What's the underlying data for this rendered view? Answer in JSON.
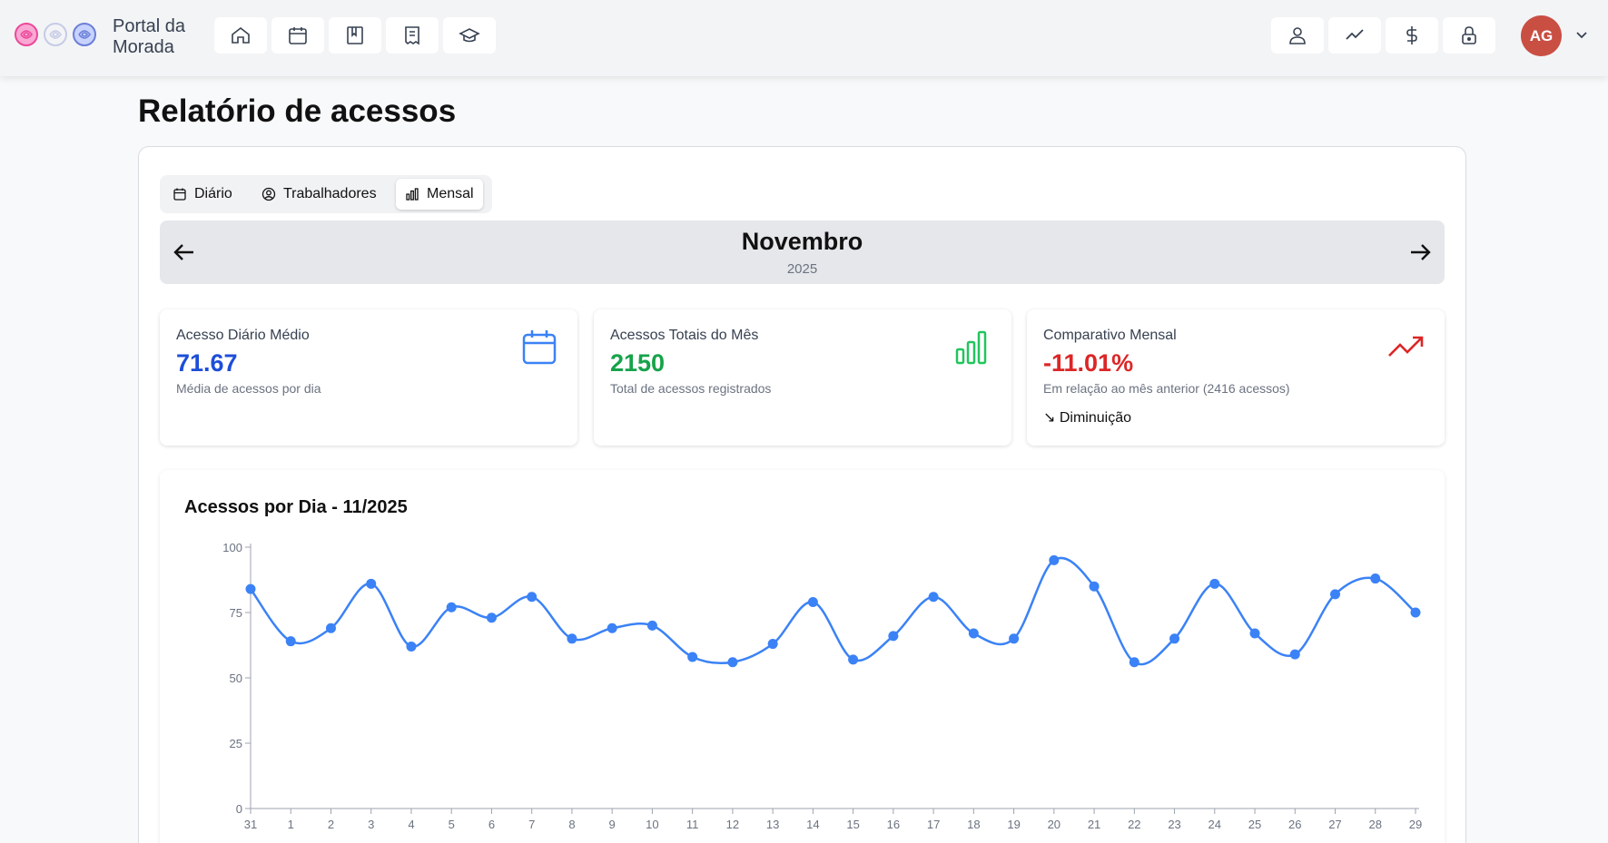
{
  "header": {
    "brand_line1": "Portal da",
    "brand_line2": "Morada",
    "avatar_initials": "AG",
    "avatar_color": "#c94f43"
  },
  "page": {
    "title": "Relatório de acessos"
  },
  "tabs": [
    {
      "label": "Diário",
      "icon": "calendar-icon",
      "active": false
    },
    {
      "label": "Trabalhadores",
      "icon": "user-circle-icon",
      "active": false
    },
    {
      "label": "Mensal",
      "icon": "bar-chart-icon",
      "active": true
    }
  ],
  "month": {
    "name": "Novembro",
    "year": "2025"
  },
  "stats": [
    {
      "label": "Acesso Diário Médio",
      "value": "71.67",
      "desc": "Média de acessos por dia",
      "color": "#1d4ed8",
      "icon": "calendar-icon"
    },
    {
      "label": "Acessos Totais do Mês",
      "value": "2150",
      "desc": "Total de acessos registrados",
      "color": "#16a34a",
      "icon": "bar-chart-icon"
    },
    {
      "label": "Comparativo Mensal",
      "value": "-11.01%",
      "desc": "Em relação ao mês anterior (2416 acessos)",
      "trend": "↘ Diminuição",
      "color": "#dc2626",
      "icon": "trending-up-icon"
    }
  ],
  "chart_data": {
    "type": "line",
    "title": "Acessos por Dia - 11/2025",
    "categories": [
      "31",
      "1",
      "2",
      "3",
      "4",
      "5",
      "6",
      "7",
      "8",
      "9",
      "10",
      "11",
      "12",
      "13",
      "14",
      "15",
      "16",
      "17",
      "18",
      "19",
      "20",
      "21",
      "22",
      "23",
      "24",
      "25",
      "26",
      "27",
      "28",
      "29"
    ],
    "series": [
      {
        "values": [
          84,
          64,
          69,
          86,
          62,
          77,
          73,
          81,
          65,
          69,
          70,
          58,
          56,
          63,
          79,
          57,
          66,
          81,
          67,
          65,
          95,
          85,
          56,
          65,
          86,
          67,
          59,
          82,
          88,
          75
        ]
      }
    ],
    "yticks": [
      0,
      25,
      50,
      75,
      100
    ],
    "ylim": [
      0,
      100
    ],
    "line_color": "#3b82f6",
    "grid": false
  }
}
